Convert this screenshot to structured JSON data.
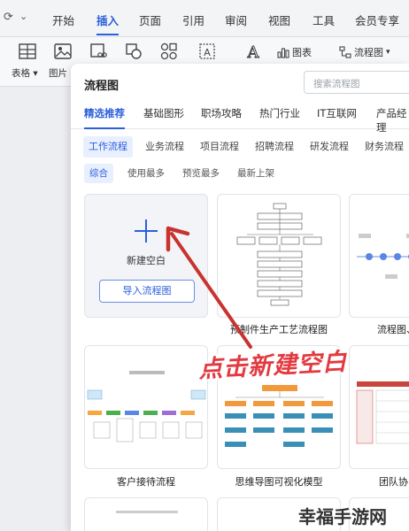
{
  "menubar": {
    "tabs": [
      "开始",
      "插入",
      "页面",
      "引用",
      "审阅",
      "视图",
      "工具",
      "会员专享"
    ],
    "active_tab": "插入"
  },
  "toolbar": {
    "table_label": "表格",
    "picture_label": "图片",
    "chart_label": "图表",
    "flowchart_label": "流程图"
  },
  "dialog": {
    "title": "流程图",
    "search_placeholder": "搜索流程图",
    "categories": [
      "精选推荐",
      "基础图形",
      "职场攻略",
      "热门行业",
      "IT互联网",
      "产品经理"
    ],
    "subcategories": [
      "工作流程",
      "业务流程",
      "项目流程",
      "招聘流程",
      "研发流程",
      "财务流程"
    ],
    "filters": [
      "综合",
      "使用最多",
      "预览最多",
      "最新上架"
    ],
    "blank_card": {
      "title": "新建空白",
      "import_button": "导入流程图"
    },
    "templates": [
      {
        "label": "预制件生产工艺流程图"
      },
      {
        "label": "流程图、"
      },
      {
        "label": "客户接待流程"
      },
      {
        "label": "思维导图可视化模型"
      },
      {
        "label": "团队协"
      }
    ]
  },
  "overlay_caption": "点击新建空白",
  "watermark": "幸福手游网",
  "colors": {
    "accent": "#2c5fdb",
    "arrow": "#c8332f",
    "caption": "#e23a40"
  }
}
